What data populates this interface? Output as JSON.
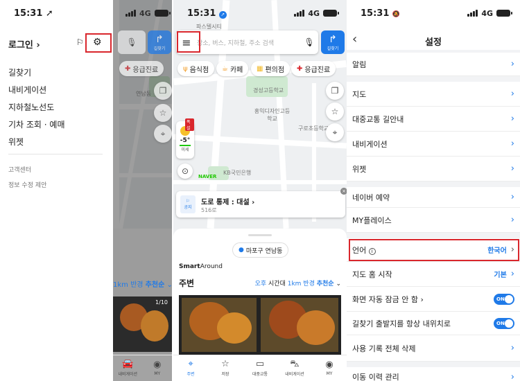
{
  "status": {
    "time1": "15:31",
    "time2": "15:31",
    "time3": "15:31",
    "network": "4G"
  },
  "panel1": {
    "login": "로그인",
    "menu": [
      "길찾기",
      "내비게이션",
      "지하철노선도",
      "기차 조회 · 예매",
      "위젯"
    ],
    "sub": [
      "고객센터",
      "정보 수정 제안"
    ],
    "route_label": "길찾기",
    "emergency": "응급진료",
    "map_label": "연남동",
    "radius_text": "1km 반경",
    "recommend": "추천순",
    "counter": "1/10",
    "tabs": [
      "내비게이션",
      "MY"
    ]
  },
  "panel2": {
    "search_placeholder": "장소, 버스, 지하철, 주소 검색",
    "route_label": "길찾기",
    "chips": [
      "음식점",
      "카페",
      "편의점",
      "응급진료"
    ],
    "weather_badge": "폭설",
    "temperature": "-5°",
    "dust": "미세",
    "map_labels": [
      "파스텔시티",
      "경성고등학교",
      "홍익디자인고등학교",
      "연남동",
      "구로초등학교",
      "KB국민은행"
    ],
    "naver": "NAVER",
    "notice_tag": "공지",
    "notice_title": "도로 통제 : 대설",
    "notice_sub": "516로",
    "location": "마포구 연남동",
    "smart": "Smart",
    "around": "Around",
    "nearby": "주변",
    "time_label": "오후",
    "time_text": "시간대",
    "radius_text": "1km 반경",
    "recommend": "추천순",
    "tabs": [
      "주변",
      "저장",
      "대중교통",
      "내비게이션",
      "MY"
    ]
  },
  "panel3": {
    "title": "설정",
    "rows": [
      "알림",
      "지도",
      "대중교통 길안내",
      "내비게이션",
      "위젯",
      "네이버 예약",
      "MY플레이스",
      "언어",
      "지도 홈 시작",
      "화면 자동 잠금 안 함",
      "길찾기 출발지를 항상 내위치로",
      "사용 기록 전체 삭제",
      "이동 이력 관리"
    ],
    "language_value": "한국어",
    "home_value": "기본",
    "toggle_on": "ON"
  },
  "colors": {
    "accent": "#1f7ae8",
    "highlight": "#d9262c",
    "map_bg": "#eef0f2"
  }
}
